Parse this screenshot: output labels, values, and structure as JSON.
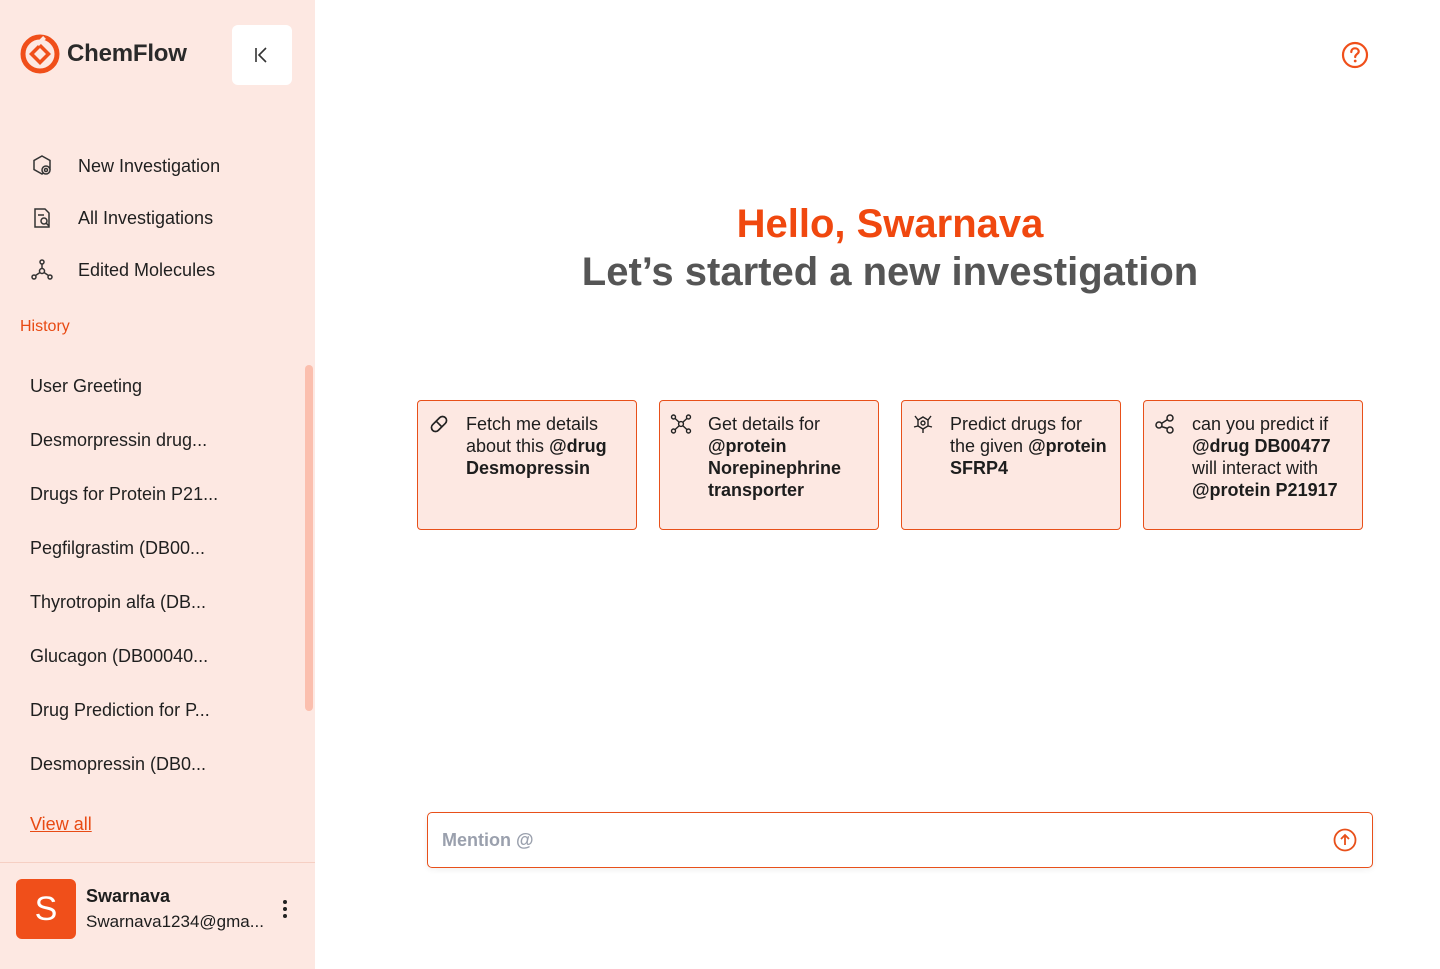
{
  "brand": {
    "name": "ChemFlow",
    "accent": "#F04F1A"
  },
  "nav": {
    "items": [
      {
        "label": "New Investigation",
        "icon": "flask-gear-icon"
      },
      {
        "label": "All Investigations",
        "icon": "document-search-icon"
      },
      {
        "label": "Edited Molecules",
        "icon": "molecule-icon"
      }
    ]
  },
  "history": {
    "title": "History",
    "items": [
      "User Greeting",
      "Desmorpressin drug...",
      "Drugs for Protein P21...",
      "Pegfilgrastim (DB00...",
      "Thyrotropin alfa (DB...",
      "Glucagon (DB00040...",
      "Drug Prediction for P...",
      "Desmopressin (DB0..."
    ],
    "view_all": "View all"
  },
  "user": {
    "initial": "S",
    "name": "Swarnava",
    "email": "Swarnava1234@gma..."
  },
  "greeting": {
    "hello": "Hello, Swarnava",
    "subtitle": "Let’s started a new investigation"
  },
  "cards": [
    {
      "icon": "pill-icon",
      "text": "Fetch me details about this ",
      "bold": "@drug Desmopressin"
    },
    {
      "icon": "network-icon",
      "text": "Get details for ",
      "bold": "@protein Norepinephrine transporter"
    },
    {
      "icon": "biohazard-molecule-icon",
      "text": "Predict drugs for the given ",
      "bold": "@protein SFRP4"
    },
    {
      "icon": "share-nodes-icon",
      "text": "can you predict if ",
      "bold": "@drug DB00477",
      "text2": " will interact with ",
      "bold2": "@protein P21917"
    }
  ],
  "input": {
    "placeholder": "Mention @",
    "value": ""
  }
}
